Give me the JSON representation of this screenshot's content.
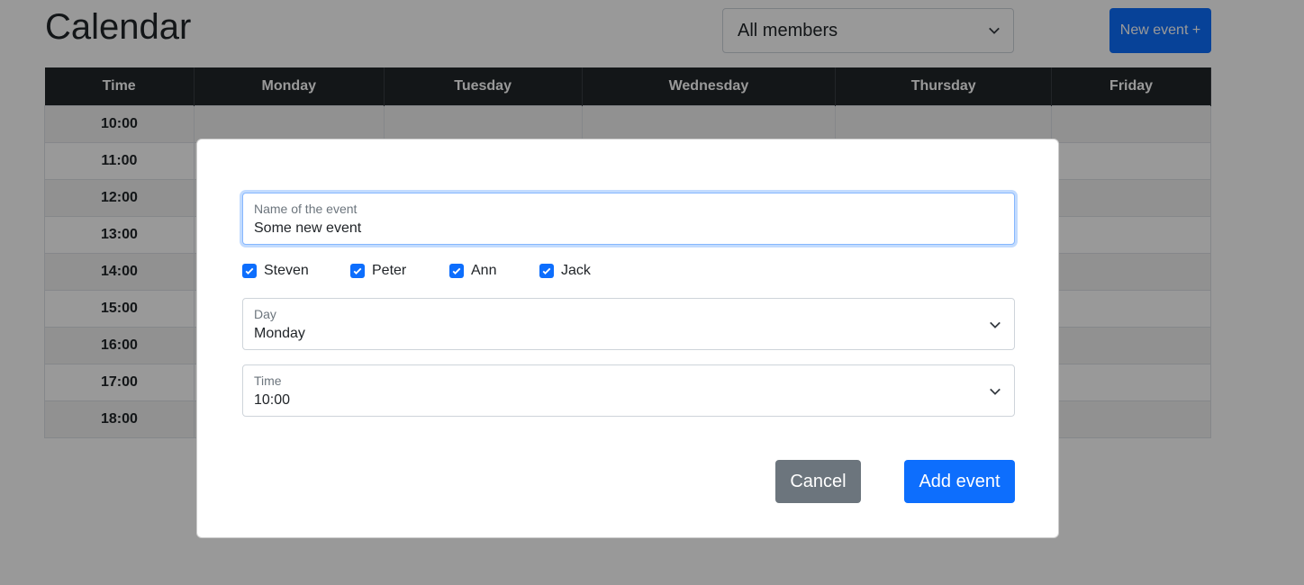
{
  "header": {
    "title": "Calendar",
    "member_filter": "All members",
    "new_event_label": "New event +"
  },
  "table": {
    "columns": [
      "Time",
      "Monday",
      "Tuesday",
      "Wednesday",
      "Thursday",
      "Friday"
    ],
    "times": [
      "10:00",
      "11:00",
      "12:00",
      "13:00",
      "14:00",
      "15:00",
      "16:00",
      "17:00",
      "18:00"
    ]
  },
  "modal": {
    "name_field": {
      "label": "Name of the event",
      "value": "Some new event"
    },
    "members": [
      {
        "name": "Steven",
        "checked": true
      },
      {
        "name": "Peter",
        "checked": true
      },
      {
        "name": "Ann",
        "checked": true
      },
      {
        "name": "Jack",
        "checked": true
      }
    ],
    "day_field": {
      "label": "Day",
      "value": "Monday"
    },
    "time_field": {
      "label": "Time",
      "value": "10:00"
    },
    "cancel_label": "Cancel",
    "add_label": "Add event"
  },
  "icons": {
    "dropdown": "chevron-down-icon",
    "check": "checkmark-icon"
  },
  "colors": {
    "primary": "#0d6efd",
    "secondary": "#6c757d",
    "header_bg": "#212529"
  }
}
